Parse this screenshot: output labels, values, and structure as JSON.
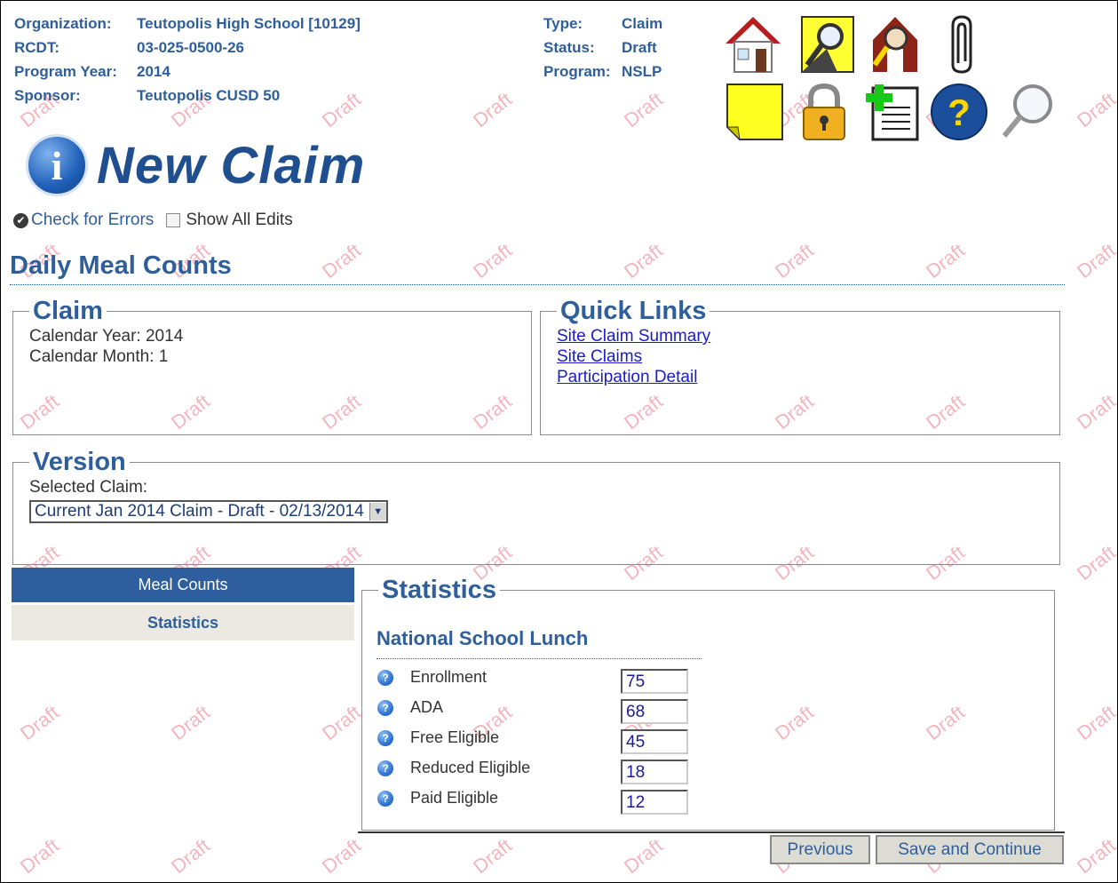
{
  "header": {
    "left": [
      {
        "key": "Organization:",
        "value": "Teutopolis High School [10129]"
      },
      {
        "key": "RCDT:",
        "value": "03-025-0500-26"
      },
      {
        "key": "Program Year:",
        "value": "2014"
      },
      {
        "key": "Sponsor:",
        "value": "Teutopolis CUSD 50"
      }
    ],
    "middle": [
      {
        "key": "Type:",
        "value": "Claim"
      },
      {
        "key": "Status:",
        "value": "Draft"
      },
      {
        "key": "Program:",
        "value": "NSLP"
      }
    ]
  },
  "toolbar_icons": [
    "home-icon",
    "search-map-icon",
    "school-lookup-icon",
    "paperclip-icon",
    "sticky-note-icon",
    "lock-icon",
    "add-document-icon",
    "help-icon",
    "magnifier-icon"
  ],
  "page": {
    "title": "New Claim",
    "check_errors": "Check for Errors",
    "show_all_edits": "Show All Edits",
    "section_title": "Daily Meal Counts",
    "watermark": "Draft"
  },
  "claim": {
    "legend": "Claim",
    "calendar_year": "Calendar Year: 2014",
    "calendar_month": "Calendar Month: 1"
  },
  "quick_links": {
    "legend": "Quick Links",
    "links": [
      "Site Claim Summary",
      "Site Claims",
      "Participation Detail"
    ]
  },
  "version": {
    "legend": "Version",
    "label": "Selected Claim:",
    "selected": "Current Jan 2014 Claim - Draft - 02/13/2014"
  },
  "nav": {
    "items": [
      "Meal Counts",
      "Statistics"
    ],
    "active": "Meal Counts"
  },
  "statistics": {
    "legend": "Statistics",
    "program": "National School Lunch",
    "rows": [
      {
        "label": "Enrollment",
        "value": "75"
      },
      {
        "label": "ADA",
        "value": "68"
      },
      {
        "label": "Free Eligible",
        "value": "45"
      },
      {
        "label": "Reduced Eligible",
        "value": "18"
      },
      {
        "label": "Paid Eligible",
        "value": "12"
      }
    ]
  },
  "buttons": {
    "previous": "Previous",
    "save_continue": "Save and Continue"
  },
  "colors": {
    "accent": "#2f5f9a",
    "nav_active": "#2e5e9e",
    "watermark": "#f2a9b5",
    "link": "#1a1ad0"
  }
}
